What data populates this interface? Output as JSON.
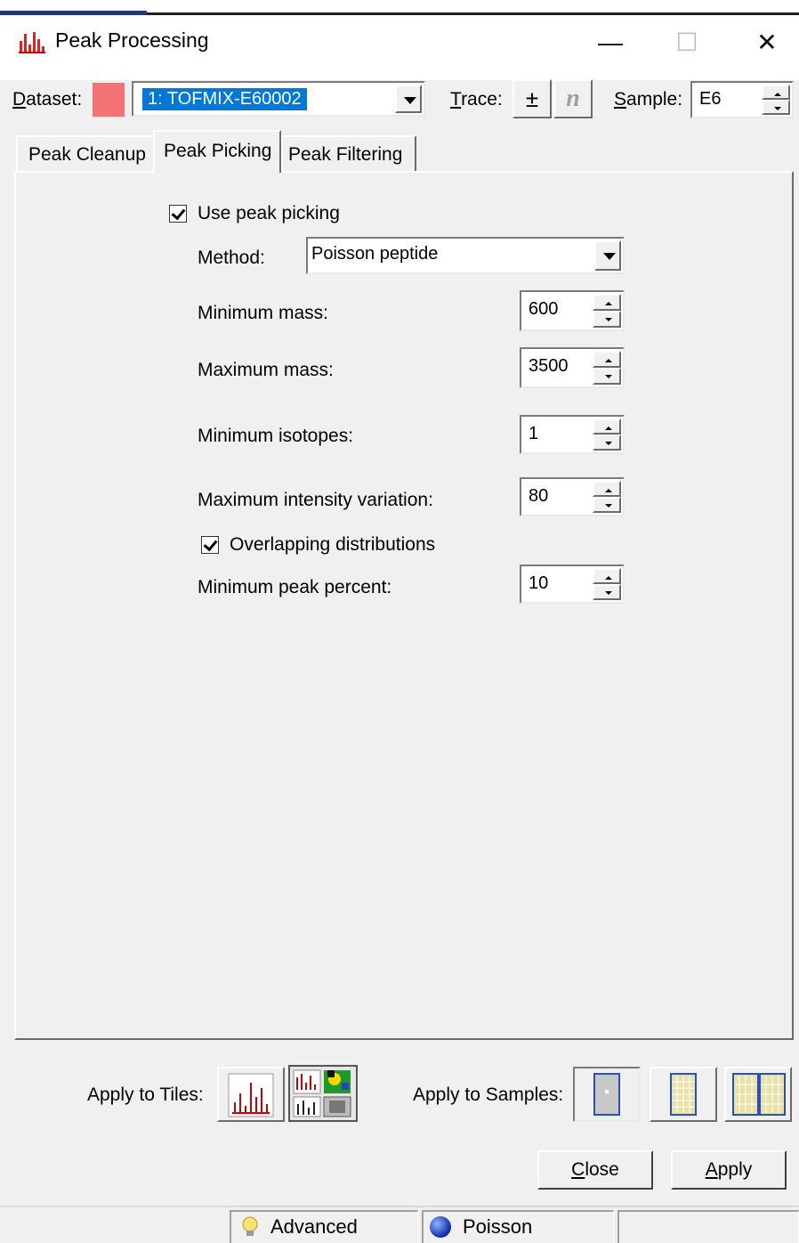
{
  "window": {
    "title": "Peak Processing",
    "minimize_glyph": "—",
    "maximize_glyph": "☐",
    "close_glyph": "✕"
  },
  "toolbar": {
    "dataset_label": "Dataset:",
    "dataset_color": "#f47174",
    "dataset_value": "1: TOFMIX-E60002",
    "trace_label": "Trace:",
    "trace_btn1": "±",
    "trace_btn2": "n",
    "sample_label": "Sample:",
    "sample_value": "E6"
  },
  "tabs": [
    {
      "label": "Peak Cleanup"
    },
    {
      "label": "Peak Picking"
    },
    {
      "label": "Peak Filtering"
    }
  ],
  "form": {
    "use_peak_picking": "Use peak picking",
    "method_label": "Method:",
    "method_value": "Poisson peptide",
    "min_mass_label": "Minimum mass:",
    "min_mass_value": "600",
    "max_mass_label": "Maximum mass:",
    "max_mass_value": "3500",
    "min_isotopes_label": "Minimum isotopes:",
    "min_isotopes_value": "1",
    "max_intensity_label": "Maximum intensity variation:",
    "max_intensity_value": "80",
    "overlapping_label": "Overlapping distributions",
    "min_peak_percent_label": "Minimum peak percent:",
    "min_peak_percent_value": "10"
  },
  "apply": {
    "tiles_label": "Apply to Tiles:",
    "samples_label": "Apply to Samples:"
  },
  "buttons": {
    "close": "Close",
    "apply": "Apply"
  },
  "status": {
    "advanced": "Advanced",
    "poisson": "Poisson"
  }
}
